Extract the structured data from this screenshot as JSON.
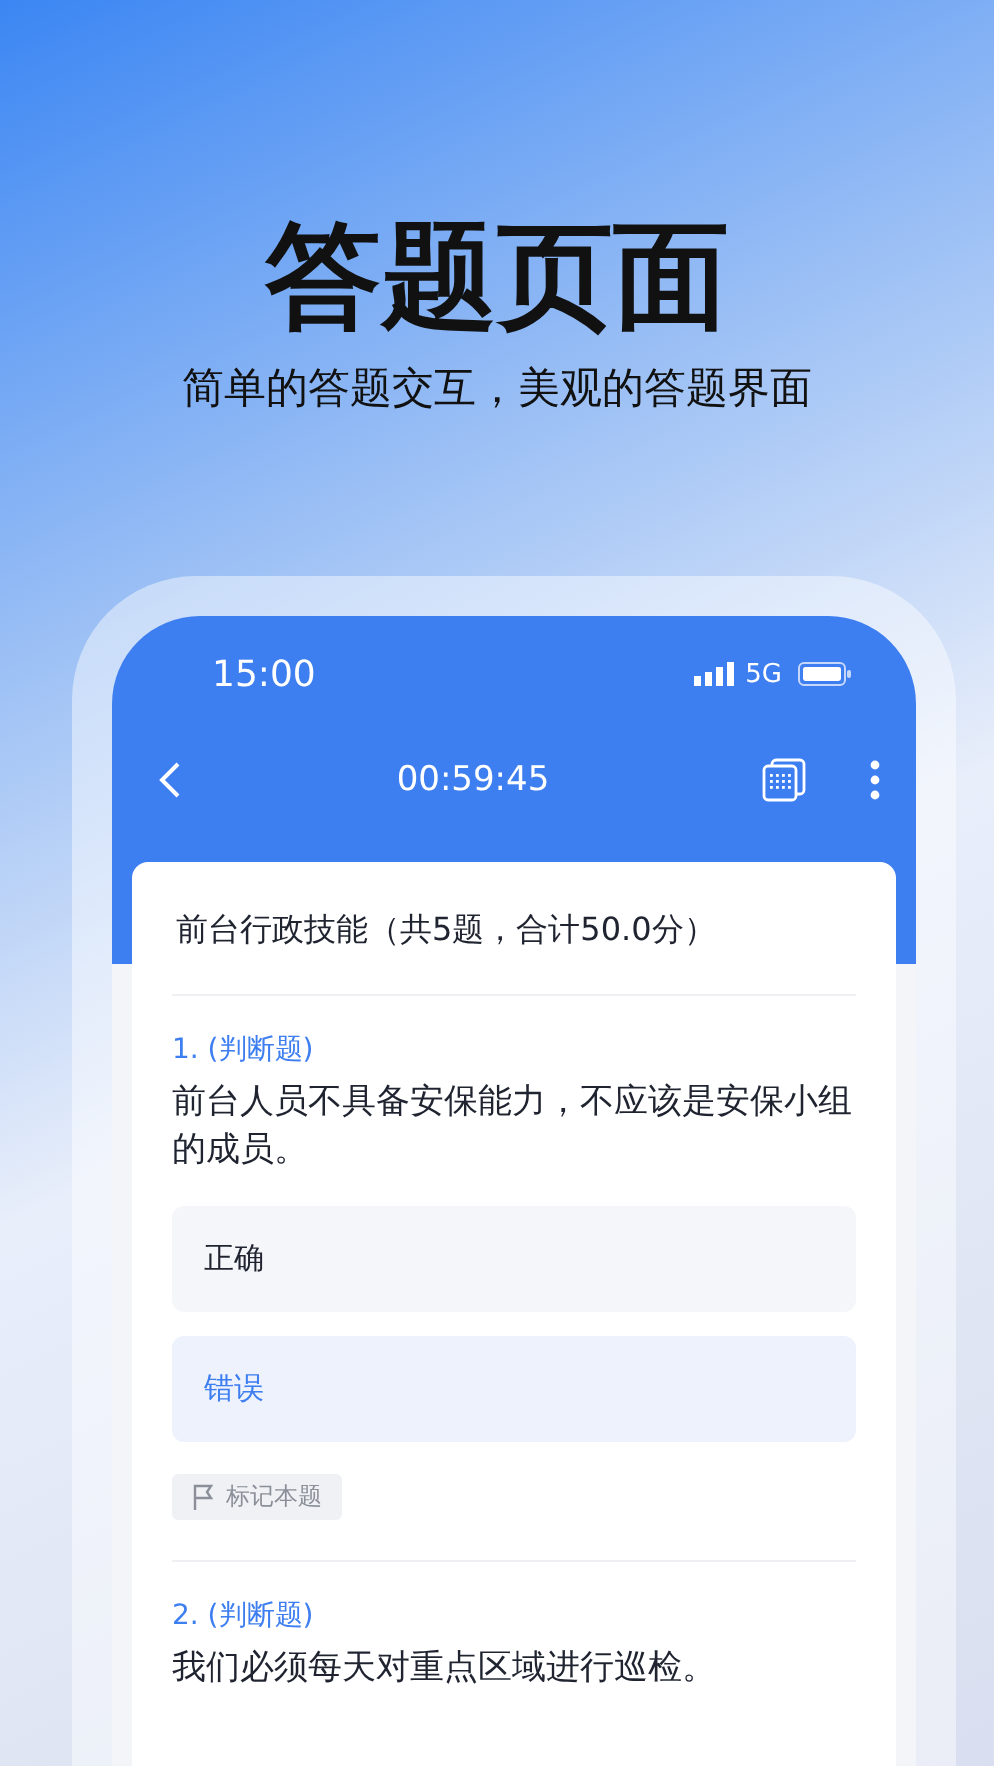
{
  "promo": {
    "title": "答题页面",
    "subtitle": "简单的答题交互，美观的答题界面"
  },
  "status_bar": {
    "time": "15:00",
    "network": "5G"
  },
  "nav_bar": {
    "timer": "00:59:45"
  },
  "exam": {
    "title": "前台行政技能（共5题，合计50.0分）",
    "questions": [
      {
        "number": "1.",
        "type": "(判断题)",
        "text": "前台人员不具备安保能力，不应该是安保小组的成员。",
        "options": [
          {
            "label": "正确",
            "selected": false
          },
          {
            "label": "错误",
            "selected": true
          }
        ],
        "flag_label": "标记本题"
      },
      {
        "number": "2.",
        "type": "(判断题)",
        "text": "我们必须每天对重点区域进行巡检。"
      }
    ]
  }
}
